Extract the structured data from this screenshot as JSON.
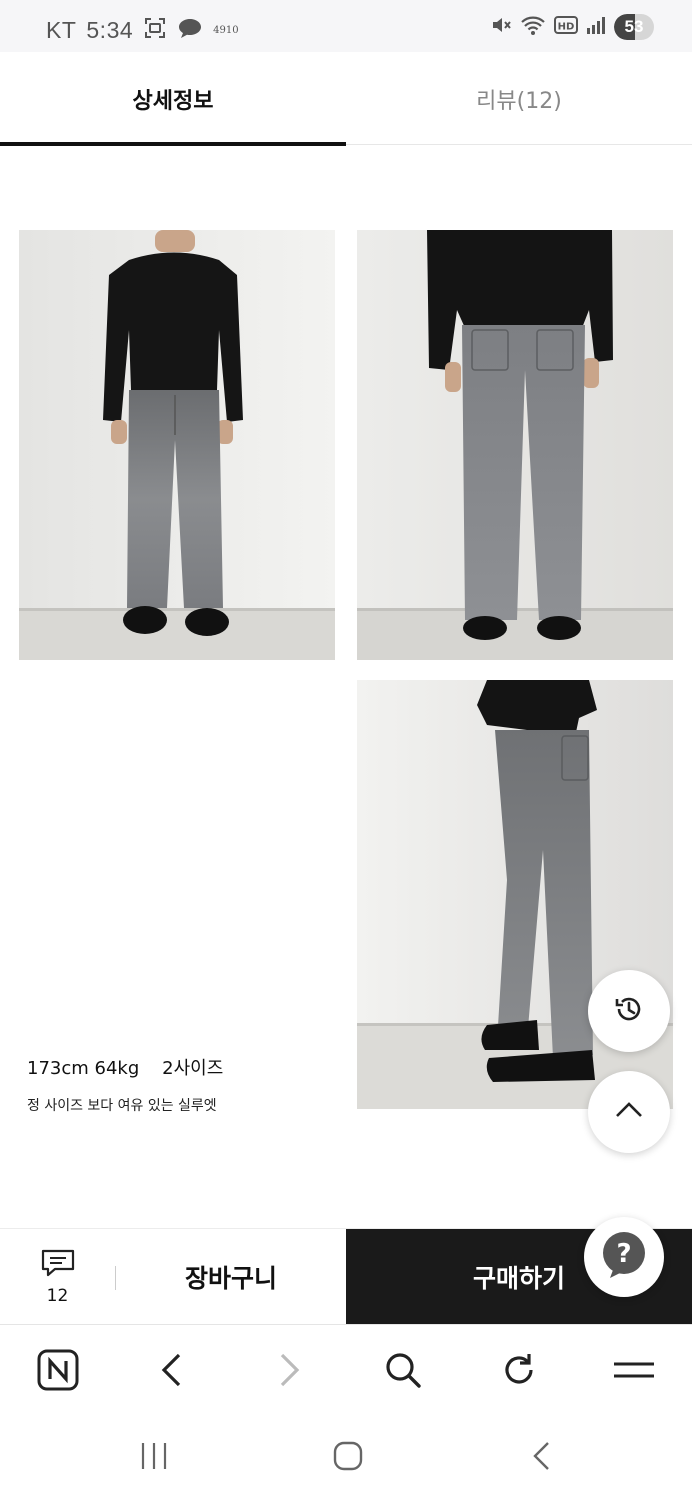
{
  "status_bar": {
    "carrier": "KT",
    "time": "5:34",
    "notification_text": "4910",
    "battery_level": "53",
    "battery_fraction": 0.53
  },
  "tabs": [
    {
      "label": "상세정보",
      "active": true
    },
    {
      "label": "리뷰(12)",
      "active": false
    }
  ],
  "model_info": {
    "specs": "173cm 64kg    2사이즈",
    "fit_note": "정 사이즈 보다 여유 있는 실루엣"
  },
  "purchase_bar": {
    "review_count": "12",
    "cart_label": "장바구니",
    "buy_label": "구매하기"
  },
  "icons": {
    "status": [
      "screenshot-icon",
      "chat-bubble-icon",
      "mute-icon",
      "wifi-icon",
      "hd-icon",
      "signal-icon"
    ],
    "browser": [
      "naver-home-icon",
      "back-arrow-icon",
      "forward-arrow-icon",
      "search-icon",
      "refresh-icon",
      "menu-icon"
    ],
    "nav": [
      "recent-apps-icon",
      "home-icon",
      "system-back-icon"
    ]
  },
  "colors": {
    "buy_button": "#1a1a1a",
    "active_tab_underline": "#111111",
    "inactive_tab_text": "#888888",
    "status_bar_bg": "#f6f6f8"
  }
}
